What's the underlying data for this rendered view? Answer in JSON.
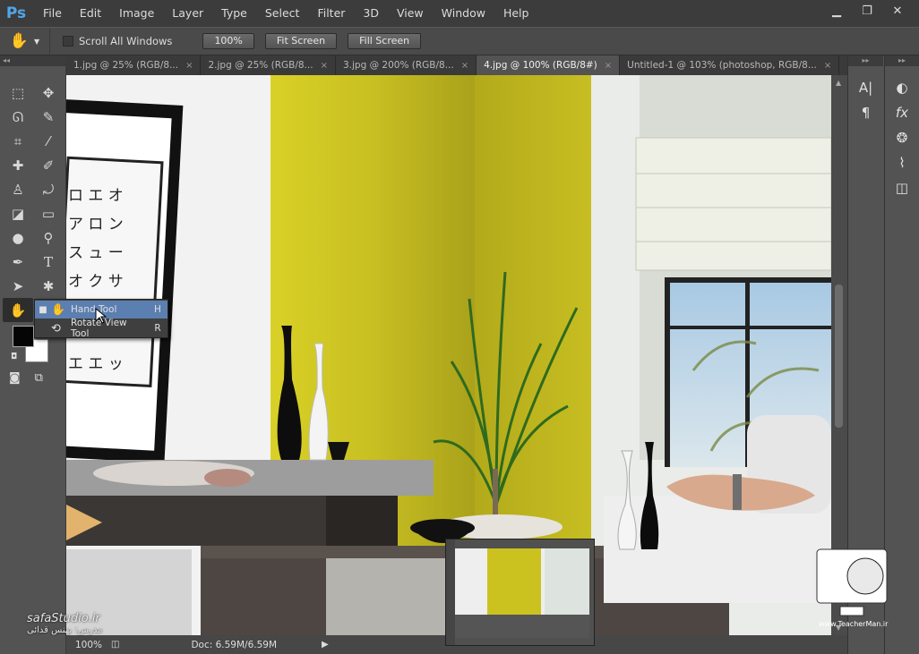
{
  "app": {
    "logo": "Ps"
  },
  "menu": [
    "File",
    "Edit",
    "Image",
    "Layer",
    "Type",
    "Select",
    "Filter",
    "3D",
    "View",
    "Window",
    "Help"
  ],
  "window_controls": [
    "minimize",
    "restore",
    "close"
  ],
  "options": {
    "scroll_all_windows": "Scroll All Windows",
    "buttons": [
      "100%",
      "Fit Screen",
      "Fill Screen"
    ]
  },
  "tabs": [
    {
      "label": "1.jpg @ 25% (RGB/8...",
      "active": false
    },
    {
      "label": "2.jpg @ 25% (RGB/8...",
      "active": false
    },
    {
      "label": "3.jpg @ 200% (RGB/8...",
      "active": false
    },
    {
      "label": "4.jpg @ 100% (RGB/8#)",
      "active": true
    },
    {
      "label": "Untitled-1 @ 103% (photoshop, RGB/8...",
      "active": false
    }
  ],
  "flyout": {
    "items": [
      {
        "label": "Hand Tool",
        "key": "H",
        "active": true
      },
      {
        "label": "Rotate View Tool",
        "key": "R",
        "active": false
      }
    ]
  },
  "artwork_text": {
    "katakana_rows": [
      "ロ エ オ",
      "ア ロ ン",
      "ス ュ ー",
      "オ ク サ",
      "エ エ ッ"
    ]
  },
  "status": {
    "zoom": "100%",
    "doc": "Doc: 6.59M/6.59M"
  },
  "watermark": {
    "left_text": "safaStudio.ir",
    "left_sub": "مدرس: بهنس قدائی",
    "right_text": "www.TeacherMan.ir"
  },
  "colors": {
    "foreground": "#050505",
    "background": "#ffffff",
    "accent": "#5b7fb0"
  }
}
